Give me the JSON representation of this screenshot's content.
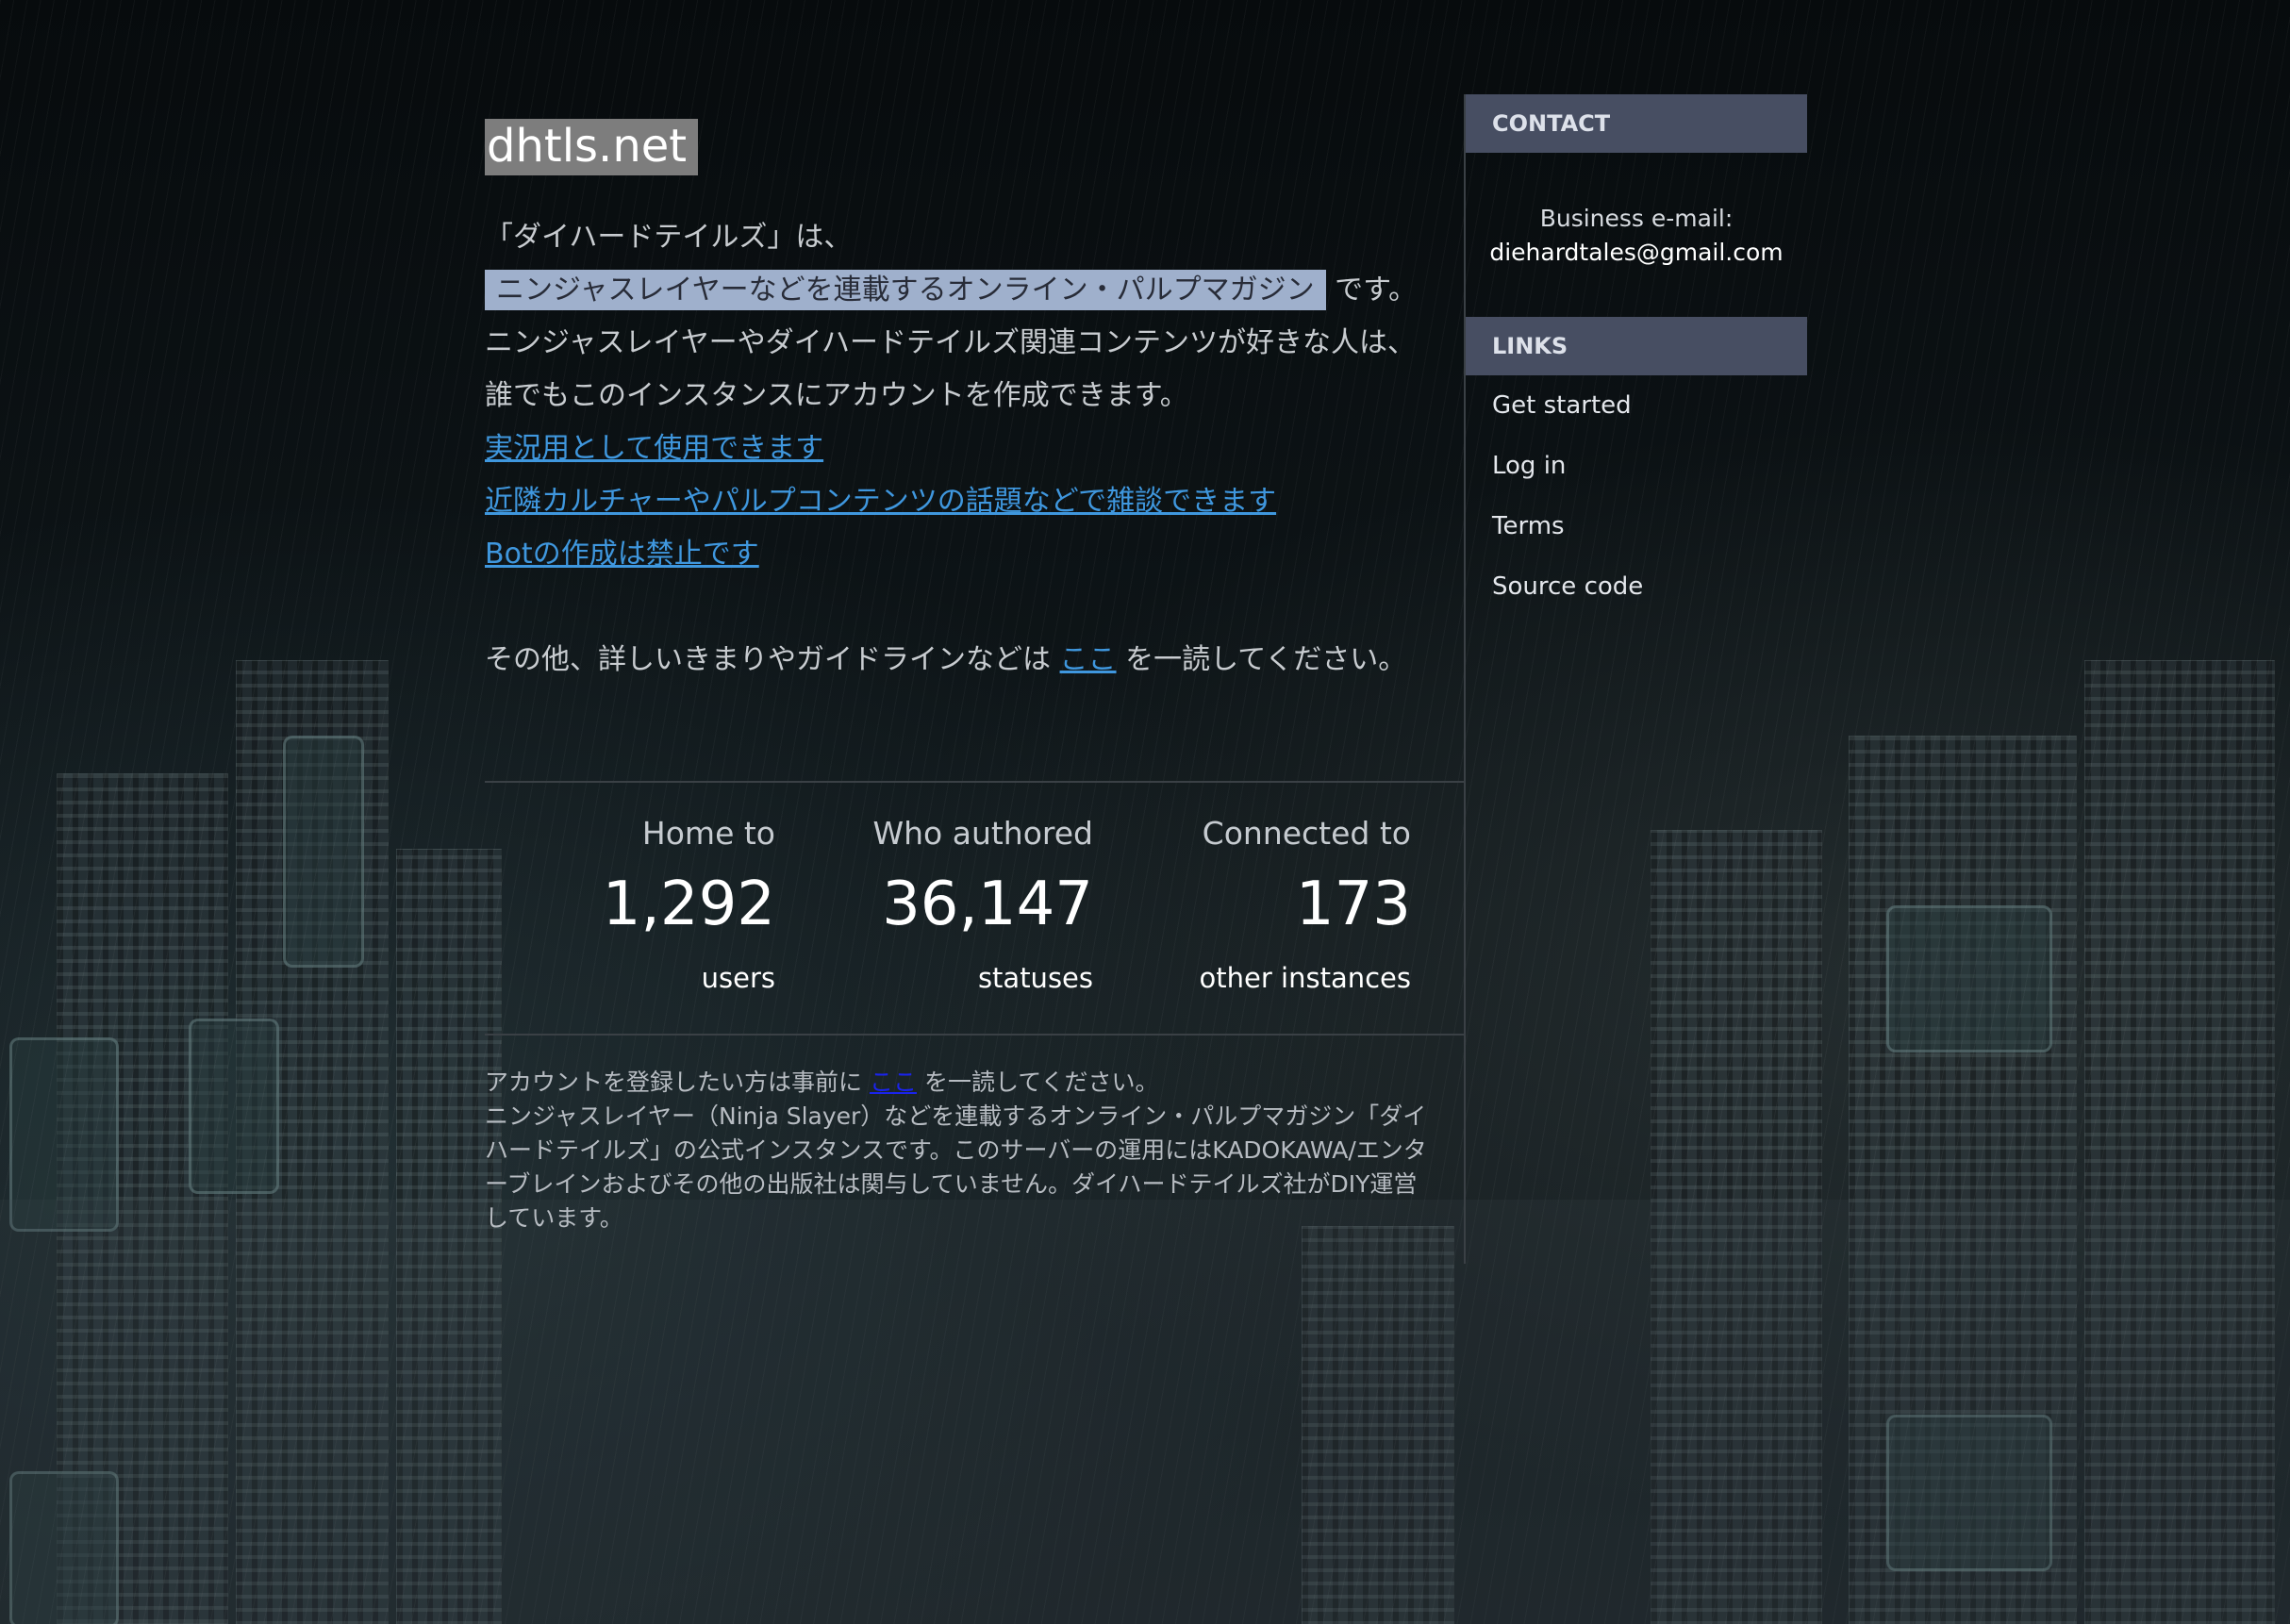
{
  "site": {
    "title": "dhtls.net"
  },
  "description": {
    "line_intro": "「ダイハードテイルズ」は、",
    "highlight": "ニンジャスレイヤーなどを連載するオンライン・パルプマガジン",
    "after_highlight": "です。ニンジャスレイヤーやダイハードテイルズ関連コンテンツが好きな人は、誰でもこのインスタンスにアカウントを作成できます。",
    "link_1": "実況用として使用できます",
    "link_2": "近隣カルチャーやパルプコンテンツの話題などで雑談できます",
    "link_3": "Botの作成は禁止です",
    "rules_prefix": "その他、詳しいきまりやガイドラインなどは",
    "rules_link": "ここ",
    "rules_suffix": "を一読してください。"
  },
  "stats": [
    {
      "label": "Home to",
      "value": "1,292",
      "unit": "users"
    },
    {
      "label": "Who authored",
      "value": "36,147",
      "unit": "statuses"
    },
    {
      "label": "Connected to",
      "value": "173",
      "unit": "other instances"
    }
  ],
  "footer": {
    "prefix": "アカウントを登録したい方は事前に",
    "link": "ここ",
    "suffix": "を一読してください。",
    "body": "ニンジャスレイヤー（Ninja Slayer）などを連載するオンライン・パルプマガジン「ダイハードテイルズ」の公式インスタンスです。このサーバーの運用にはKADOKAWA/エンターブレインおよびその他の出版社は関与していません。ダイハードテイルズ社がDIY運営しています。"
  },
  "sidebar": {
    "contact_heading": "CONTACT",
    "contact_label": "Business e-mail:",
    "contact_email": "diehardtales@gmail.com",
    "links_heading": "LINKS",
    "links": [
      "Get started",
      "Log in",
      "Terms",
      "Source code"
    ]
  }
}
